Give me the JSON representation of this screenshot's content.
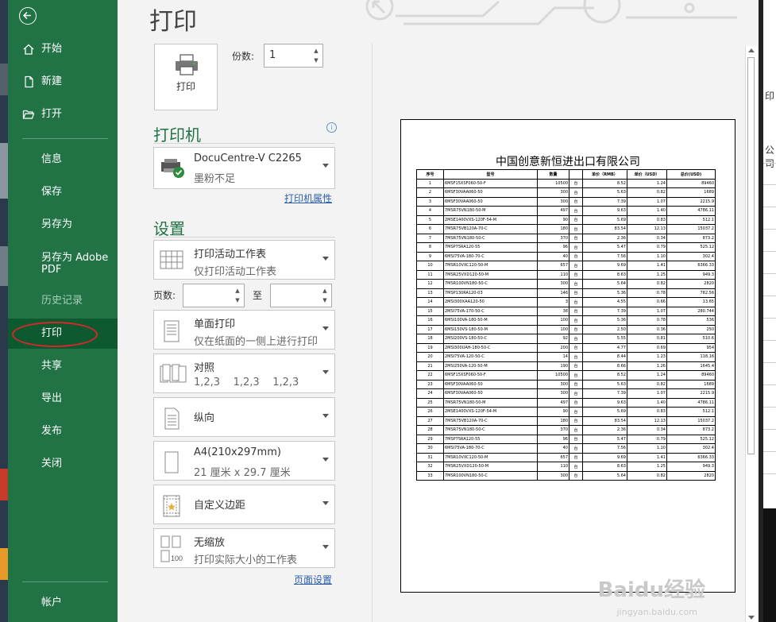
{
  "sidebar": {
    "items": [
      {
        "label": "开始",
        "icon": "home-icon"
      },
      {
        "label": "新建",
        "icon": "new-document-icon"
      },
      {
        "label": "打开",
        "icon": "open-folder-icon"
      },
      {
        "label": "信息"
      },
      {
        "label": "保存"
      },
      {
        "label": "另存为"
      },
      {
        "label": "另存为 Adobe PDF"
      },
      {
        "label": "历史记录"
      },
      {
        "label": "打印"
      },
      {
        "label": "共享"
      },
      {
        "label": "导出"
      },
      {
        "label": "发布"
      },
      {
        "label": "关闭"
      }
    ],
    "account": "帐户",
    "selected": "打印"
  },
  "main": {
    "title": "打印",
    "print_button": "打印",
    "copies_label": "份数:",
    "copies_value": "1",
    "printer_heading": "打印机",
    "printer": {
      "name": "DocuCentre-V C2265",
      "status": "墨粉不足"
    },
    "printer_properties": "打印机属性",
    "settings_heading": "设置",
    "settings": [
      {
        "title": "打印活动工作表",
        "sub": "仅打印活动工作表",
        "icon": "sheet-grid-icon"
      },
      {
        "title": "单面打印",
        "sub": "仅在纸面的一侧上进行打印",
        "icon": "one-sided-icon"
      },
      {
        "title": "对照",
        "sub": "1,2,3    1,2,3    1,2,3",
        "icon": "collated-icon"
      },
      {
        "title": "纵向",
        "sub": "",
        "icon": "portrait-icon"
      },
      {
        "title": "A4(210x297mm)",
        "sub": "21 厘米 x 29.7 厘米",
        "icon": "paper-size-icon"
      },
      {
        "title": "自定义边距",
        "sub": "",
        "icon": "margins-icon"
      },
      {
        "title": "无缩放",
        "sub": "打印实际大小的工作表",
        "icon": "no-scaling-icon"
      }
    ],
    "pages_label": "页数:",
    "to_label": "至",
    "page_setup": "页面设置"
  },
  "preview": {
    "title": "中国创意新恒进出口有限公司",
    "headers": [
      "序号",
      "型号",
      "数量",
      "",
      "单价（RMB）",
      "单价（USD）",
      "总价(USD)"
    ],
    "rows": [
      [
        "1",
        "6MSF15XSF060-50-F",
        "10500",
        "台",
        "8.52",
        "1.24",
        "89460"
      ],
      [
        "2",
        "6MSF30VAA060-50",
        "300",
        "台",
        "5.63",
        "0.82",
        "1689"
      ],
      [
        "3",
        "6MSF30VAA060-50",
        "300",
        "台",
        "7.39",
        "1.07",
        "2215.9"
      ],
      [
        "4",
        "7MSR75VN180-50-M",
        "497",
        "台",
        "9.63",
        "1.40",
        "4786.11"
      ],
      [
        "5",
        "2MSE1400VXS-120F-54-M",
        "90",
        "台",
        "5.69",
        "0.83",
        "512.1"
      ],
      [
        "6",
        "7MSR75VB120A-70-C",
        "180",
        "台",
        "83.54",
        "12.13",
        "15037.2"
      ],
      [
        "7",
        "7MSR75VN180-50-C",
        "370",
        "台",
        "2.36",
        "0.34",
        "873.2"
      ],
      [
        "8",
        "7MSP75RA120-55",
        "96",
        "台",
        "5.47",
        "0.79",
        "525.12"
      ],
      [
        "9",
        "6MSI75VA-180-70-C",
        "40",
        "台",
        "7.56",
        "1.10",
        "302.4"
      ],
      [
        "10",
        "7MSR10VXC120-50-M",
        "657",
        "台",
        "9.69",
        "1.41",
        "6366.33"
      ],
      [
        "11",
        "7MSR25VXD120-50-M",
        "110",
        "台",
        "8.63",
        "1.25",
        "949.3"
      ],
      [
        "12",
        "7MSR100VN180-50-C",
        "300",
        "台",
        "5.64",
        "0.82",
        "2820"
      ],
      [
        "13",
        "7MSP130RA120-03",
        "146",
        "台",
        "5.36",
        "0.78",
        "782.56"
      ],
      [
        "14",
        "2MSI300XAA120-50",
        "3",
        "台",
        "4.55",
        "0.66",
        "13.65"
      ],
      [
        "15",
        "2MSI75VA-170-50-C",
        "38",
        "台",
        "7.39",
        "1.07",
        "280.744"
      ],
      [
        "16",
        "6MSI100VA-180-50-M",
        "100",
        "台",
        "5.36",
        "0.78",
        "536"
      ],
      [
        "17",
        "6MSI150VS-180-50-M",
        "100",
        "台",
        "2.50",
        "0.36",
        "250"
      ],
      [
        "18",
        "2MSI200VS-180-50-C",
        "92",
        "台",
        "5.55",
        "0.81",
        "510.6"
      ],
      [
        "19",
        "2MSI300UAH-180-50-C",
        "200",
        "台",
        "4.77",
        "0.69",
        "954"
      ],
      [
        "20",
        "2MSI75VA-120-50-C",
        "14",
        "台",
        "8.44",
        "1.23",
        "118.16"
      ],
      [
        "21",
        "2MSI250VA-120-50-M",
        "190",
        "台",
        "8.66",
        "1.26",
        "1645.4"
      ],
      [
        "22",
        "6MSF15XSF060-50-F",
        "10500",
        "台",
        "8.52",
        "1.24",
        "89460"
      ],
      [
        "23",
        "6MSF30VAA060-50",
        "300",
        "台",
        "5.63",
        "0.82",
        "1689"
      ],
      [
        "24",
        "6MSF30VAA060-50",
        "300",
        "台",
        "7.39",
        "1.07",
        "2215.9"
      ],
      [
        "25",
        "7MSR75VN180-50-M",
        "497",
        "台",
        "9.63",
        "1.40",
        "4786.11"
      ],
      [
        "26",
        "2MSE1400VXS-120F-54-M",
        "90",
        "台",
        "5.69",
        "0.83",
        "512.1"
      ],
      [
        "27",
        "7MSR75VB120A-70-C",
        "180",
        "台",
        "83.54",
        "12.13",
        "15037.2"
      ],
      [
        "28",
        "7MSR75VN180-50-C",
        "370",
        "台",
        "2.36",
        "0.34",
        "873.2"
      ],
      [
        "29",
        "7MSP75RA120-55",
        "96",
        "台",
        "5.47",
        "0.79",
        "525.12"
      ],
      [
        "30",
        "6MSI75VA-180-70-C",
        "40",
        "台",
        "7.56",
        "1.10",
        "302.4"
      ],
      [
        "31",
        "7MSR10VXC120-50-M",
        "657",
        "台",
        "9.69",
        "1.41",
        "6366.33"
      ],
      [
        "32",
        "7MSR25VXD120-50-M",
        "110",
        "台",
        "8.63",
        "1.25",
        "949.3"
      ],
      [
        "33",
        "7MSR100VN180-50-C",
        "300",
        "台",
        "5.64",
        "0.82",
        "2820"
      ]
    ]
  },
  "background_window": {
    "texts": [
      "印",
      "公司"
    ]
  },
  "watermark": {
    "brand": "Baidu经验",
    "url": "jingyan.baidu.com"
  }
}
